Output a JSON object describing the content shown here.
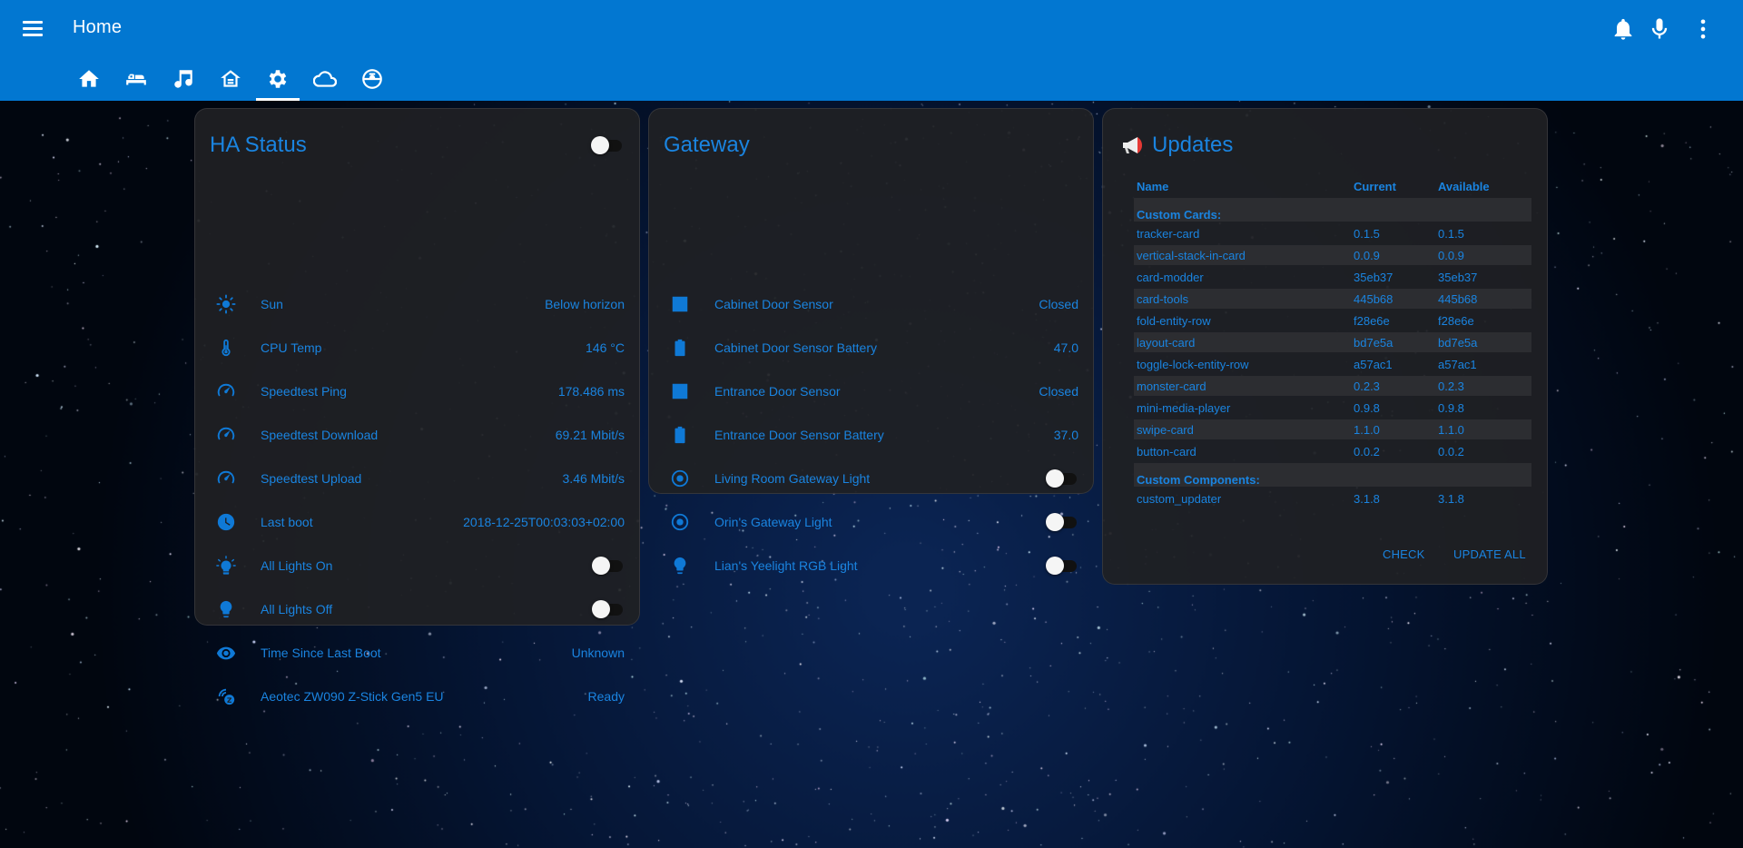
{
  "app": {
    "title": "Home"
  },
  "tabs": [
    {
      "icon": "home-icon"
    },
    {
      "icon": "bed-icon"
    },
    {
      "icon": "music-icon"
    },
    {
      "icon": "house-outline-icon"
    },
    {
      "icon": "gear-icon",
      "active": true
    },
    {
      "icon": "cloud-icon"
    },
    {
      "icon": "robot-vacuum-icon"
    }
  ],
  "ha_status": {
    "title": "HA Status",
    "header_toggle": "off",
    "rows": [
      {
        "icon": "sun-icon",
        "name": "Sun",
        "value": "Below horizon"
      },
      {
        "icon": "thermometer-icon",
        "name": "CPU Temp",
        "value": "146 °C"
      },
      {
        "icon": "speedometer-icon",
        "name": "Speedtest Ping",
        "value": "178.486 ms"
      },
      {
        "icon": "speedometer-icon",
        "name": "Speedtest Download",
        "value": "69.21 Mbit/s"
      },
      {
        "icon": "speedometer-icon",
        "name": "Speedtest Upload",
        "value": "3.46 Mbit/s"
      },
      {
        "icon": "clock-icon",
        "name": "Last boot",
        "value": "2018-12-25T00:03:03+02:00"
      },
      {
        "icon": "lightbulb-on-icon",
        "name": "All Lights On",
        "toggle": "off"
      },
      {
        "icon": "lightbulb-icon",
        "name": "All Lights Off",
        "toggle": "off"
      },
      {
        "icon": "eye-icon",
        "name": "Time Since Last Boot",
        "value": "Unknown"
      },
      {
        "icon": "z-wave-icon",
        "name": "Aeotec ZW090 Z-Stick Gen5 EU",
        "value": "Ready"
      }
    ]
  },
  "gateway": {
    "title": "Gateway",
    "rows": [
      {
        "icon": "square-icon",
        "name": "Cabinet Door Sensor",
        "value": "Closed"
      },
      {
        "icon": "battery-icon",
        "name": "Cabinet Door Sensor Battery",
        "value": "47.0"
      },
      {
        "icon": "square-icon",
        "name": "Entrance Door Sensor",
        "value": "Closed"
      },
      {
        "icon": "battery-icon",
        "name": "Entrance Door Sensor Battery",
        "value": "37.0"
      },
      {
        "icon": "radiobox-icon",
        "name": "Living Room Gateway Light",
        "toggle": "off"
      },
      {
        "icon": "radiobox-icon",
        "name": "Orin's Gateway Light",
        "toggle": "off"
      },
      {
        "icon": "lightbulb-icon",
        "name": "Lian's Yeelight RGB Light",
        "toggle": "off"
      }
    ]
  },
  "updates": {
    "title": "Updates",
    "columns": [
      "Name",
      "Current",
      "Available"
    ],
    "sections": [
      {
        "label": "Custom Cards:",
        "items": [
          [
            "tracker-card",
            "0.1.5",
            "0.1.5"
          ],
          [
            "vertical-stack-in-card",
            "0.0.9",
            "0.0.9"
          ],
          [
            "card-modder",
            "35eb37",
            "35eb37"
          ],
          [
            "card-tools",
            "445b68",
            "445b68"
          ],
          [
            "fold-entity-row",
            "f28e6e",
            "f28e6e"
          ],
          [
            "layout-card",
            "bd7e5a",
            "bd7e5a"
          ],
          [
            "toggle-lock-entity-row",
            "a57ac1",
            "a57ac1"
          ],
          [
            "monster-card",
            "0.2.3",
            "0.2.3"
          ],
          [
            "mini-media-player",
            "0.9.8",
            "0.9.8"
          ],
          [
            "swipe-card",
            "1.1.0",
            "1.1.0"
          ],
          [
            "button-card",
            "0.0.2",
            "0.0.2"
          ]
        ]
      },
      {
        "label": "Custom Components:",
        "items": [
          [
            "custom_updater",
            "3.1.8",
            "3.1.8"
          ]
        ]
      }
    ],
    "check_label": "CHECK",
    "update_all_label": "UPDATE ALL"
  },
  "colors": {
    "header": "#0277d1",
    "accent": "#1a84e0",
    "card_bg": "#1f2023"
  }
}
